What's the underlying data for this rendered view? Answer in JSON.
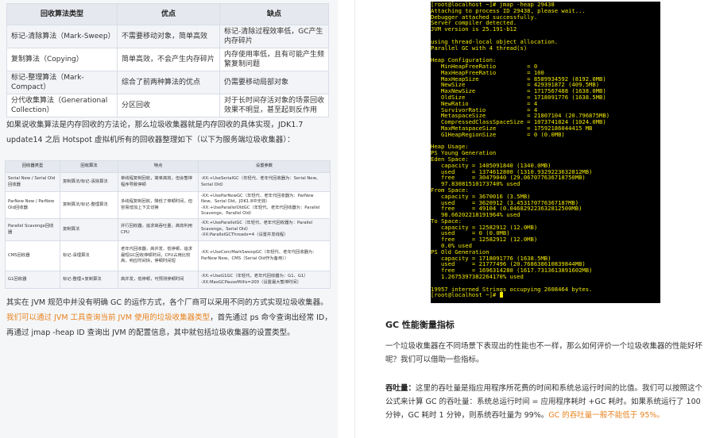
{
  "table1": {
    "headers": [
      "回收算法类型",
      "优点",
      "缺点"
    ],
    "rows": [
      [
        "标记-清除算法（Mark-Sweep）",
        "不需要移动对象，简单高效",
        "标记-清除过程效率低，GC产生内存碎片"
      ],
      [
        "复制算法（Copying）",
        "简单高效，不会产生内存碎片",
        "内存使用率低，且有可能产生频繁复制问题"
      ],
      [
        "标记-整理算法（Mark-Compact）",
        "综合了前两种算法的优点",
        "仍需要移动局部对象"
      ],
      [
        "分代收集算法（Generational Collection）",
        "分区回收",
        "对于长时间存活对象的场景回收效果不明显，甚至起到反作用"
      ]
    ]
  },
  "para1": "如果说收集算法是内存回收的方法论，那么垃圾收集器就是内存回收的具体实现，JDK1.7 update14 之后 Hotspot 虚拟机所有的回收器整理如下（以下为服务端垃圾收集器）：",
  "table2": {
    "headers": [
      "回收器类型",
      "回收算法",
      "特点",
      "设置参数"
    ],
    "rows": [
      [
        "Serial New / Serial Old回收器",
        "复制算法/标记-清除算法",
        "单线程复制回收，简单高效，但会暂停程序导致停顿",
        "-XX:+UseSerialGC（年轻代、老年代回收器为：Serial New、Serial Old）"
      ],
      [
        "ParNew New / ParNew Old回收器",
        "复制算法/标记-整理算法",
        "多线程复制回收，降低了停顿时间，但容易增加上下文切换",
        "-XX:+UseParNewGC（年轻代、老年代回收器为：ParNew New、Serial Old，JDK1.8中无效）\n-XX:+UseParallelOldGC（年轻代、老年代回收器为：Parallel Scavenge、Parallel Old）"
      ],
      [
        "Parallel Scavenge回收器",
        "复制算法",
        "并行回收器，追求高吞吐量，高效利用CPU",
        "-XX:+UseParallelGC（年轻代、老年代回收器为：Parallel Scavenge、Serial Old）\n-XX:ParallelGCThreads=4（设置并发线程）"
      ],
      [
        "CMS回收器",
        "标记-清理算法",
        "老年代回收器，高并发、低停顿，追求最短GC回收停顿时间，CPU占用比较高，响应时间快，停顿时间短",
        "-XX:+UseConcMarkSweepGC（年轻代、老年代回收器为：ParNew New、CMS（Serial Old作为备用））"
      ],
      [
        "G1回收器",
        "标记-整理+复制算法",
        "高并发，低停顿，可预测停顿时间",
        "-XX:+UseG1GC（年轻代、老年代回收器为：G1、G1）\n-XX:MaxGCPauseMillis=200（设置最大暂停时间）"
      ]
    ]
  },
  "para2": {
    "part1": "其实在 JVM 规范中并没有明确 GC 的运作方式，各个厂商可以采用不同的方式实现垃圾收集器。",
    "highlight": "我们可以通过 JVM 工具查询当前 JVM 使用的垃圾收集器类型",
    "part2": "，首先通过 ps 命令查询出经常 ID，再通过 jmap -heap ID 查询出 JVM 的配置信息，其中就包括垃圾收集器的设置类型。"
  },
  "terminal": {
    "lines": [
      "[root@localhost ~]# jmap -heap 29438",
      "Attaching to process ID 29438, please wait...",
      "Debugger attached successfully.",
      "Server compiler detected.",
      "JVM version is 25.191-b12",
      "",
      "using thread-local object allocation.",
      "Parallel GC with 4 thread(s)",
      "",
      "Heap Configuration:",
      "   MinHeapFreeRatio         = 0",
      "   MaxHeapFreeRatio         = 100",
      "   MaxHeapSize              = 8589934592 (8192.0MB)",
      "   NewSize                  = 429391872 (409.5MB)",
      "   MaxNewSize               = 1717567488 (1638.0MB)",
      "   OldSize                  = 1718091776 (1638.5MB)",
      "   NewRatio                 = 4",
      "   SurvivorRatio            = 4",
      "   MetaspaceSize            = 21807104 (20.796875MB)",
      "   CompressedClassSpaceSize = 1073741824 (1024.0MB)",
      "   MaxMetaspaceSize         = 17592186044415 MB",
      "   G1HeapRegionSize         = 0 (0.0MB)",
      "",
      "Heap Usage:",
      "PS Young Generation",
      "Eden Space:",
      "   capacity = 1405091840 (1340.0MB)",
      "   used     = 1374612800 (1310.9329223632812MB)",
      "   free     = 30479040 (29.067077636718750MB)",
      "   97.83081510173740% used",
      "From Space:",
      "   capacity = 3670016 (3.5MB)",
      "   used     = 3620912 (3.453170776367187MB)",
      "   free     = 49104 (0.046829223632812500MB)",
      "   98.66202218191964% used",
      "To Space:",
      "   capacity = 12582912 (12.0MB)",
      "   used     = 0 (0.0MB)",
      "   free     = 12582912 (12.0MB)",
      "   0.0% used",
      "PS Old Generation",
      "   capacity = 1718091776 (1638.5MB)",
      "   used     = 21777496 (20.768638610839844MB)",
      "   free     = 1696314280 (1617.7313613891602MB)",
      "   1.2675397382264170% used",
      "",
      "19957 interned Strings occupying 2608464 bytes.",
      "[root@localhost ~]# "
    ]
  },
  "right": {
    "heading": "GC 性能衡量指标",
    "para1": "一个垃圾收集器在不同场景下表现出的性能也不一样，那么如何评价一个垃圾收集器的性能好坏呢？我们可以借助一些指标。",
    "label": "吞吐量：",
    "para2": "这里的吞吐量是指应用程序所花费的时间和系统总运行时间的比值。我们可以按照这个公式来计算 GC 的吞吐量：系统总运行时间 = 应用程序耗时 +GC 耗时。如果系统运行了 100 分钟，GC 耗时 1 分钟，则系统吞吐量为 99%。",
    "highlight": "GC 的吞吐量一般不能低于 95%。"
  },
  "colors": {
    "highlight": "#e8821e",
    "terminal_fg": "#f2e900",
    "terminal_bg": "#000000"
  }
}
